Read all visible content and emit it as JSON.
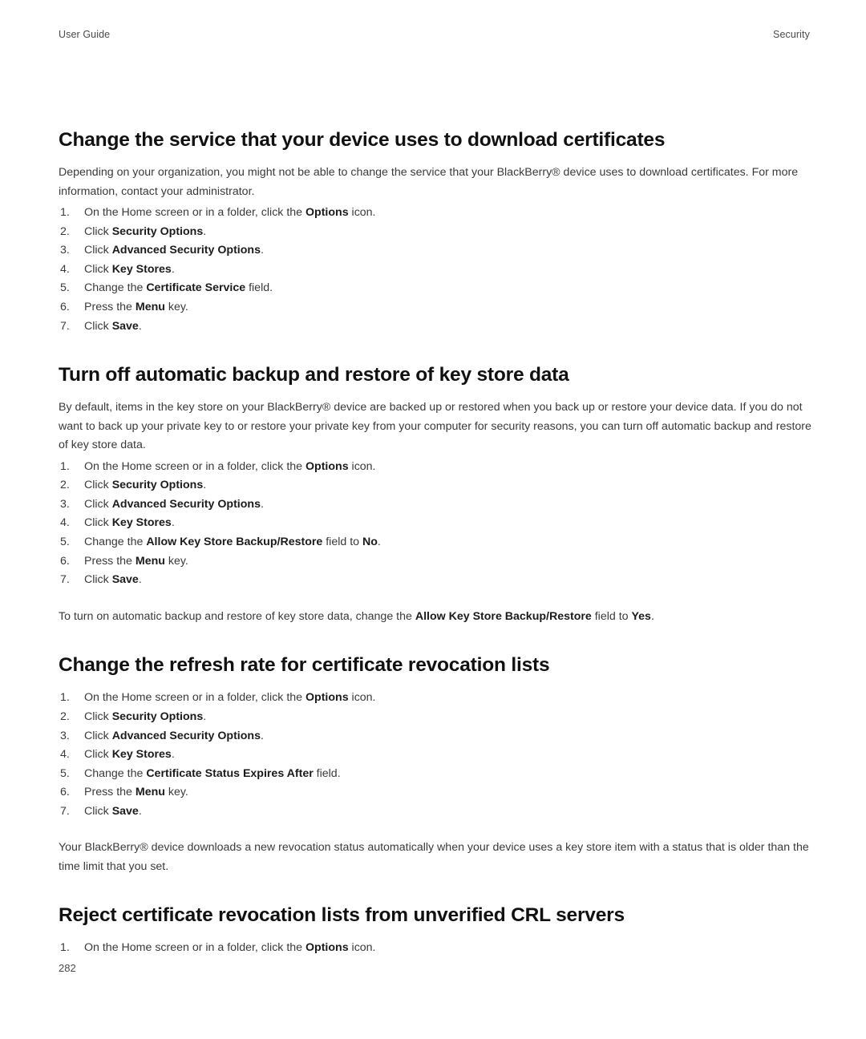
{
  "header": {
    "left": "User Guide",
    "right": "Security"
  },
  "footer": {
    "page_number": "282"
  },
  "sections": [
    {
      "title": "Change the service that your device uses to download certificates",
      "intro": [
        {
          "t": "Depending on your organization, you might not be able to change the service that your BlackBerry® device uses to download certificates. For more information, contact your administrator.",
          "b": false
        }
      ],
      "steps": [
        {
          "num": "1.",
          "parts": [
            {
              "t": "On the Home screen or in a folder, click the ",
              "b": false
            },
            {
              "t": "Options",
              "b": true
            },
            {
              "t": " icon.",
              "b": false
            }
          ]
        },
        {
          "num": "2.",
          "parts": [
            {
              "t": "Click ",
              "b": false
            },
            {
              "t": "Security Options",
              "b": true
            },
            {
              "t": ".",
              "b": false
            }
          ]
        },
        {
          "num": "3.",
          "parts": [
            {
              "t": "Click ",
              "b": false
            },
            {
              "t": "Advanced Security Options",
              "b": true
            },
            {
              "t": ".",
              "b": false
            }
          ]
        },
        {
          "num": "4.",
          "parts": [
            {
              "t": "Click ",
              "b": false
            },
            {
              "t": "Key Stores",
              "b": true
            },
            {
              "t": ".",
              "b": false
            }
          ]
        },
        {
          "num": "5.",
          "parts": [
            {
              "t": "Change the ",
              "b": false
            },
            {
              "t": "Certificate Service",
              "b": true
            },
            {
              "t": " field.",
              "b": false
            }
          ]
        },
        {
          "num": "6.",
          "parts": [
            {
              "t": "Press the ",
              "b": false
            },
            {
              "t": "Menu",
              "b": true
            },
            {
              "t": " key.",
              "b": false
            }
          ]
        },
        {
          "num": "7.",
          "parts": [
            {
              "t": "Click ",
              "b": false
            },
            {
              "t": "Save",
              "b": true
            },
            {
              "t": ".",
              "b": false
            }
          ]
        }
      ],
      "trailing": []
    },
    {
      "title": "Turn off automatic backup and restore of key store data",
      "intro": [
        {
          "t": "By default, items in the key store on your BlackBerry® device are backed up or restored when you back up or restore your device data. If you do not want to back up your private key to or restore your private key from your computer for security reasons, you can turn off automatic backup and restore of key store data.",
          "b": false
        }
      ],
      "steps": [
        {
          "num": "1.",
          "parts": [
            {
              "t": "On the Home screen or in a folder, click the ",
              "b": false
            },
            {
              "t": "Options",
              "b": true
            },
            {
              "t": " icon.",
              "b": false
            }
          ]
        },
        {
          "num": "2.",
          "parts": [
            {
              "t": "Click ",
              "b": false
            },
            {
              "t": "Security Options",
              "b": true
            },
            {
              "t": ".",
              "b": false
            }
          ]
        },
        {
          "num": "3.",
          "parts": [
            {
              "t": "Click ",
              "b": false
            },
            {
              "t": "Advanced Security Options",
              "b": true
            },
            {
              "t": ".",
              "b": false
            }
          ]
        },
        {
          "num": "4.",
          "parts": [
            {
              "t": "Click ",
              "b": false
            },
            {
              "t": "Key Stores",
              "b": true
            },
            {
              "t": ".",
              "b": false
            }
          ]
        },
        {
          "num": "5.",
          "parts": [
            {
              "t": "Change the ",
              "b": false
            },
            {
              "t": "Allow Key Store Backup/Restore",
              "b": true
            },
            {
              "t": " field to ",
              "b": false
            },
            {
              "t": "No",
              "b": true
            },
            {
              "t": ".",
              "b": false
            }
          ]
        },
        {
          "num": "6.",
          "parts": [
            {
              "t": "Press the ",
              "b": false
            },
            {
              "t": "Menu",
              "b": true
            },
            {
              "t": " key.",
              "b": false
            }
          ]
        },
        {
          "num": "7.",
          "parts": [
            {
              "t": "Click ",
              "b": false
            },
            {
              "t": "Save",
              "b": true
            },
            {
              "t": ".",
              "b": false
            }
          ]
        }
      ],
      "trailing": [
        {
          "t": "To turn on automatic backup and restore of key store data, change the ",
          "b": false
        },
        {
          "t": "Allow Key Store Backup/Restore",
          "b": true
        },
        {
          "t": " field to ",
          "b": false
        },
        {
          "t": "Yes",
          "b": true
        },
        {
          "t": ".",
          "b": false
        }
      ]
    },
    {
      "title": "Change the refresh rate for certificate revocation lists",
      "intro": [],
      "steps": [
        {
          "num": "1.",
          "parts": [
            {
              "t": "On the Home screen or in a folder, click the ",
              "b": false
            },
            {
              "t": "Options",
              "b": true
            },
            {
              "t": " icon.",
              "b": false
            }
          ]
        },
        {
          "num": "2.",
          "parts": [
            {
              "t": "Click ",
              "b": false
            },
            {
              "t": "Security Options",
              "b": true
            },
            {
              "t": ".",
              "b": false
            }
          ]
        },
        {
          "num": "3.",
          "parts": [
            {
              "t": "Click ",
              "b": false
            },
            {
              "t": "Advanced Security Options",
              "b": true
            },
            {
              "t": ".",
              "b": false
            }
          ]
        },
        {
          "num": "4.",
          "parts": [
            {
              "t": "Click ",
              "b": false
            },
            {
              "t": "Key Stores",
              "b": true
            },
            {
              "t": ".",
              "b": false
            }
          ]
        },
        {
          "num": "5.",
          "parts": [
            {
              "t": "Change the ",
              "b": false
            },
            {
              "t": "Certificate Status Expires After",
              "b": true
            },
            {
              "t": " field.",
              "b": false
            }
          ]
        },
        {
          "num": "6.",
          "parts": [
            {
              "t": "Press the ",
              "b": false
            },
            {
              "t": "Menu",
              "b": true
            },
            {
              "t": " key.",
              "b": false
            }
          ]
        },
        {
          "num": "7.",
          "parts": [
            {
              "t": "Click ",
              "b": false
            },
            {
              "t": "Save",
              "b": true
            },
            {
              "t": ".",
              "b": false
            }
          ]
        }
      ],
      "trailing": [
        {
          "t": "Your BlackBerry® device downloads a new revocation status automatically when your device uses a key store item with a status that is older than the time limit that you set.",
          "b": false
        }
      ]
    },
    {
      "title": "Reject certificate revocation lists from unverified CRL servers",
      "intro": [],
      "steps": [
        {
          "num": "1.",
          "parts": [
            {
              "t": "On the Home screen or in a folder, click the ",
              "b": false
            },
            {
              "t": "Options",
              "b": true
            },
            {
              "t": " icon.",
              "b": false
            }
          ]
        }
      ],
      "trailing": []
    }
  ]
}
